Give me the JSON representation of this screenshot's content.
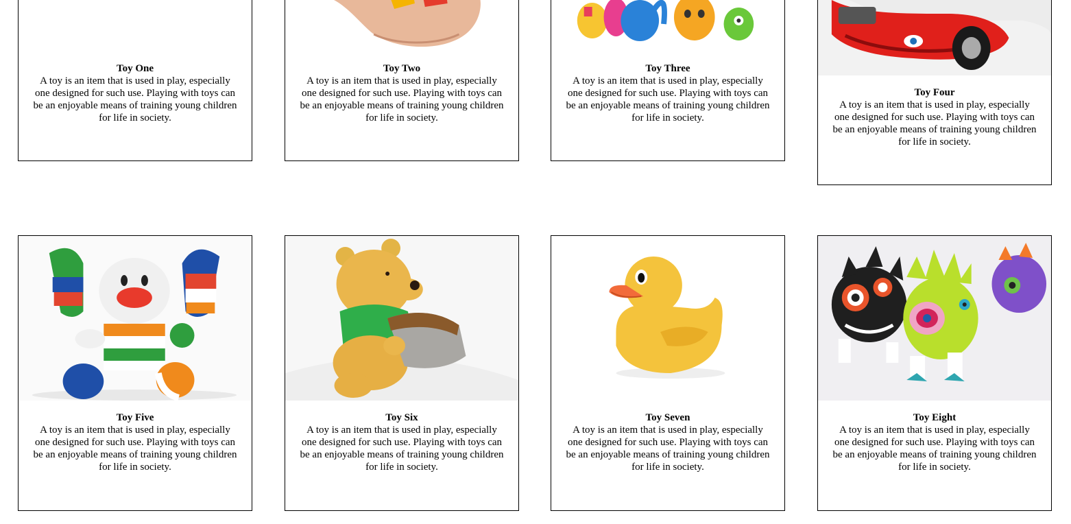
{
  "cards": [
    {
      "title": "Toy One",
      "description": "A toy is an item that is used in play, especially one designed for such use. Playing with toys can be an enjoyable means of training young children for life in society.",
      "image": "hand-toy-image"
    },
    {
      "title": "Toy Two",
      "description": "A toy is an item that is used in play, especially one designed for such use. Playing with toys can be an enjoyable means of training young children for life in society.",
      "image": "hand-holding-toy-image"
    },
    {
      "title": "Toy Three",
      "description": "A toy is an item that is used in play, especially one designed for such use. Playing with toys can be an enjoyable means of training young children for life in society.",
      "image": "monster-figures-image"
    },
    {
      "title": "Toy Four",
      "description": "A toy is an item that is used in play, especially one designed for such use. Playing with toys can be an enjoyable means of training young children for life in society.",
      "image": "red-toy-car-image"
    },
    {
      "title": "Toy Five",
      "description": "A toy is an item that is used in play, especially one designed for such use. Playing with toys can be an enjoyable means of training young children for life in society.",
      "image": "striped-bunny-plush-image"
    },
    {
      "title": "Toy Six",
      "description": "A toy is an item that is used in play, especially one designed for such use. Playing with toys can be an enjoyable means of training young children for life in society.",
      "image": "bear-honey-pot-image"
    },
    {
      "title": "Toy Seven",
      "description": "A toy is an item that is used in play, especially one designed for such use. Playing with toys can be an enjoyable means of training young children for life in society.",
      "image": "rubber-duck-image"
    },
    {
      "title": "Toy Eight",
      "description": "A toy is an item that is used in play, especially one designed for such use. Playing with toys can be an enjoyable means of training young children for life in society.",
      "image": "spiky-monsters-image"
    }
  ]
}
